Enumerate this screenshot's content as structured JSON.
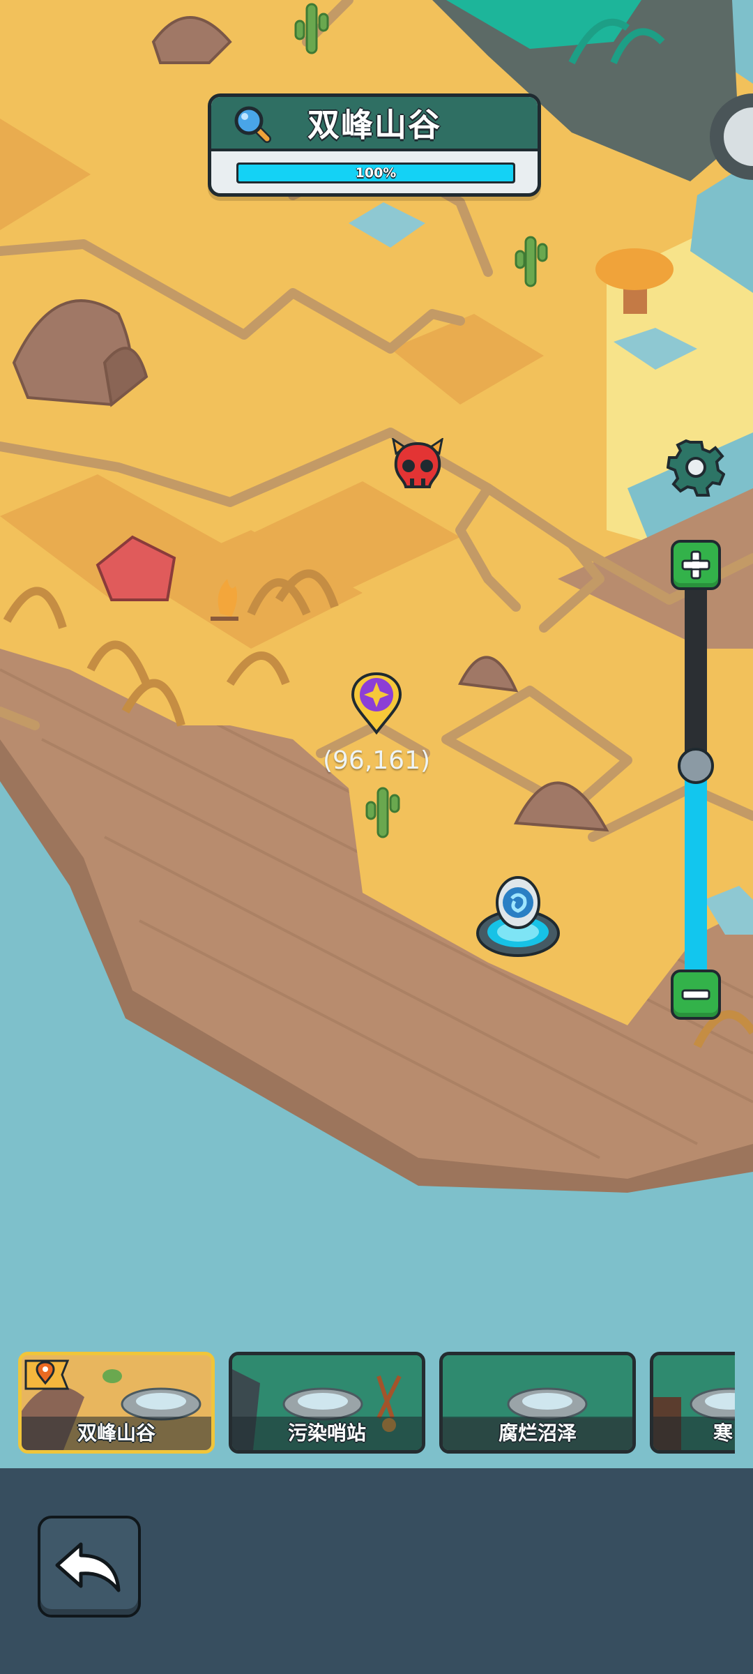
{
  "region": {
    "name": "双峰山谷",
    "progress_text": "100%",
    "progress": 1.0
  },
  "player": {
    "coords": "(96,161)"
  },
  "zoom": {
    "level": 0.52
  },
  "regions": [
    {
      "name": "双峰山谷",
      "active": true
    },
    {
      "name": "污染哨站",
      "active": false
    },
    {
      "name": "腐烂沼泽",
      "active": false
    },
    {
      "name": "寒",
      "active": false
    }
  ],
  "icons": {
    "search": "magnifier-icon",
    "settings": "gear-icon",
    "zoom_in": "plus-icon",
    "zoom_out": "minus-icon",
    "back": "undo-arrow-icon",
    "player_marker": "map-pin-icon",
    "enemy": "demon-skull-icon",
    "portal": "teleport-portal-icon",
    "current_location": "location-flag-icon"
  },
  "colors": {
    "sand": "#f2c15b",
    "cliff": "#b88c6e",
    "water": "#7ec0cb",
    "panel_green": "#2f6f63",
    "progress": "#14d2f5",
    "zoom_button": "#33b24a",
    "bottom_bar": "#374e5f"
  }
}
